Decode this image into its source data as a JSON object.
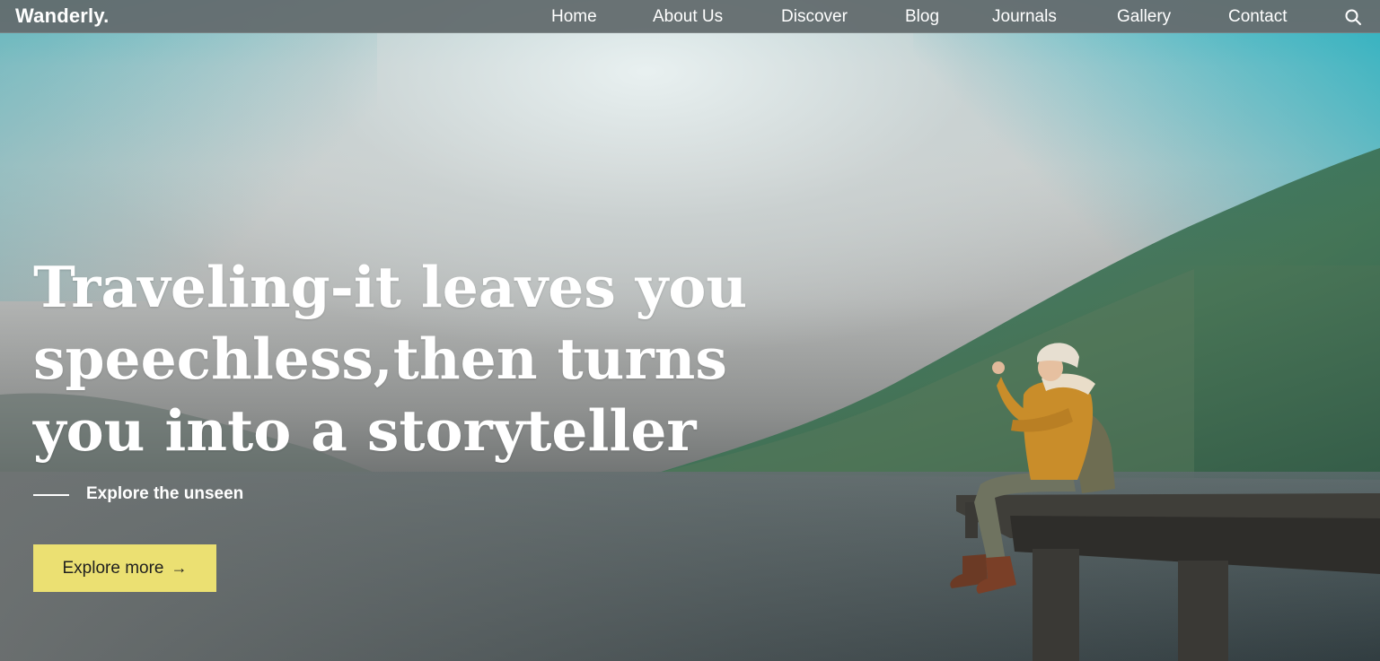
{
  "header": {
    "logo": "Wanderly.",
    "nav": [
      "Home",
      "About Us",
      "Discover",
      "Blog",
      "Journals",
      "Gallery",
      "Contact"
    ],
    "search_icon": "search-icon"
  },
  "hero": {
    "headline_lines": [
      "Traveling-it leaves you",
      "speechless,then turns",
      "you into a storyteller"
    ],
    "tagline": "Explore the unseen",
    "cta_label": "Explore more",
    "cta_icon": "arrow-right-icon",
    "colors": {
      "cta_background": "#ebe072",
      "text": "#ffffff"
    }
  }
}
